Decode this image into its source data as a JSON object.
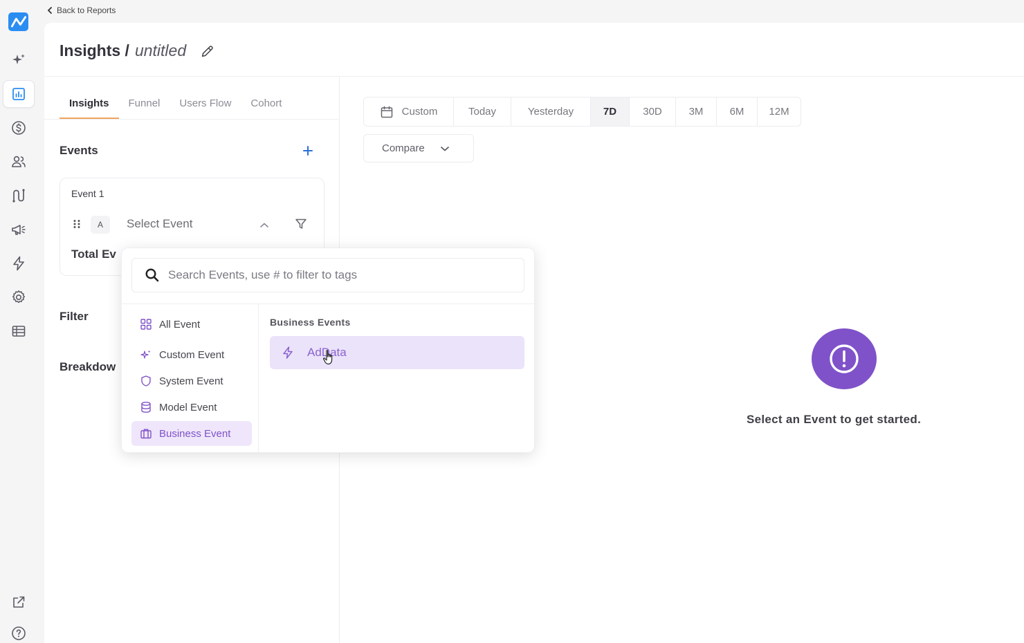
{
  "nav": {
    "back_label": "Back to Reports",
    "rail_icons": [
      "app-logo",
      "sparkle-icon",
      "reports-icon",
      "dollar-icon",
      "users-icon",
      "flow-icon",
      "megaphone-icon",
      "bolt-icon",
      "settings-icon",
      "table-icon",
      "external-link-icon",
      "help-icon"
    ]
  },
  "header": {
    "title": "Insights /",
    "subtitle": "untitled"
  },
  "tabs": [
    {
      "label": "Insights",
      "active": true
    },
    {
      "label": "Funnel",
      "active": false
    },
    {
      "label": "Users Flow",
      "active": false
    },
    {
      "label": "Cohort",
      "active": false
    }
  ],
  "builder": {
    "events_label": "Events",
    "event_card": {
      "title": "Event 1",
      "letter": "A",
      "select_placeholder": "Select Event",
      "total_label": "Total Ev"
    },
    "filter_label": "Filter",
    "breakdown_label": "Breakdow"
  },
  "range": {
    "items": [
      "Custom",
      "Today",
      "Yesterday",
      "7D",
      "30D",
      "3M",
      "6M",
      "12M"
    ],
    "active": "7D",
    "compare_label": "Compare"
  },
  "empty_state": {
    "text": "Select an Event to get started."
  },
  "popover": {
    "search_placeholder": "Search Events, use # to filter to tags",
    "categories": [
      {
        "label": "All Event",
        "icon": "grid-icon"
      },
      {
        "label": "Custom Event",
        "icon": "sparkle-icon"
      },
      {
        "label": "System Event",
        "icon": "shield-icon"
      },
      {
        "label": "Model Event",
        "icon": "database-icon"
      },
      {
        "label": "Business Event",
        "icon": "briefcase-icon"
      }
    ],
    "active_category": "Business Event",
    "group_heading": "Business Events",
    "items": [
      {
        "label": "AdData",
        "icon": "bolt-icon"
      }
    ]
  },
  "colors": {
    "accent_purple": "#7f52c9",
    "tab_underline": "#f0a35a",
    "logo_blue": "#2a8df2"
  }
}
